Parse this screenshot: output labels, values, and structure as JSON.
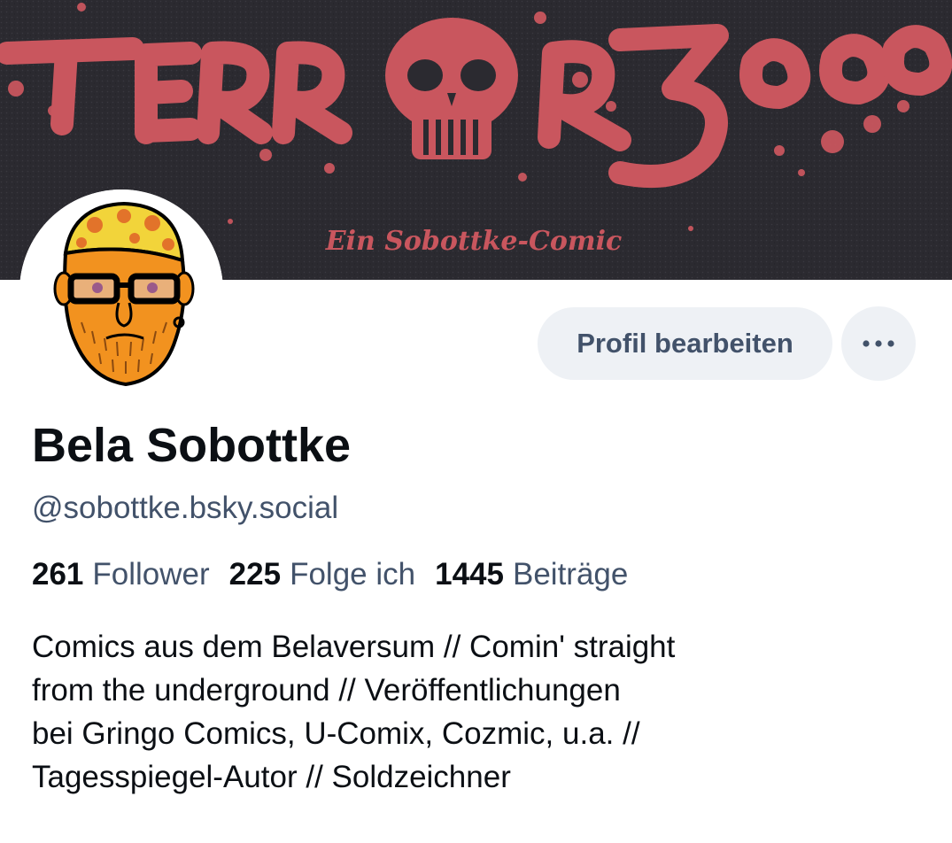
{
  "banner": {
    "title_art": "TERROR 3000",
    "subtitle_art": "Ein Sobottke-Comic",
    "ink_color": "#c9565e",
    "background_color": "#2b2a30"
  },
  "actions": {
    "edit_profile_label": "Profil bearbeiten",
    "more_icon": "ellipsis-icon"
  },
  "profile": {
    "display_name": "Bela Sobottke",
    "handle": "@sobottke.bsky.social"
  },
  "stats": [
    {
      "value": "261",
      "label": "Follower"
    },
    {
      "value": "225",
      "label": "Folge ich"
    },
    {
      "value": "1445",
      "label": "Beiträge"
    }
  ],
  "bio_lines": [
    "Comics aus dem Belaversum // Comin' straight",
    "from the underground // Veröffentlichungen",
    "bei Gringo Comics, U-Comix, Cozmic, u.a. //",
    "Tagesspiegel-Autor // Soldzeichner"
  ]
}
